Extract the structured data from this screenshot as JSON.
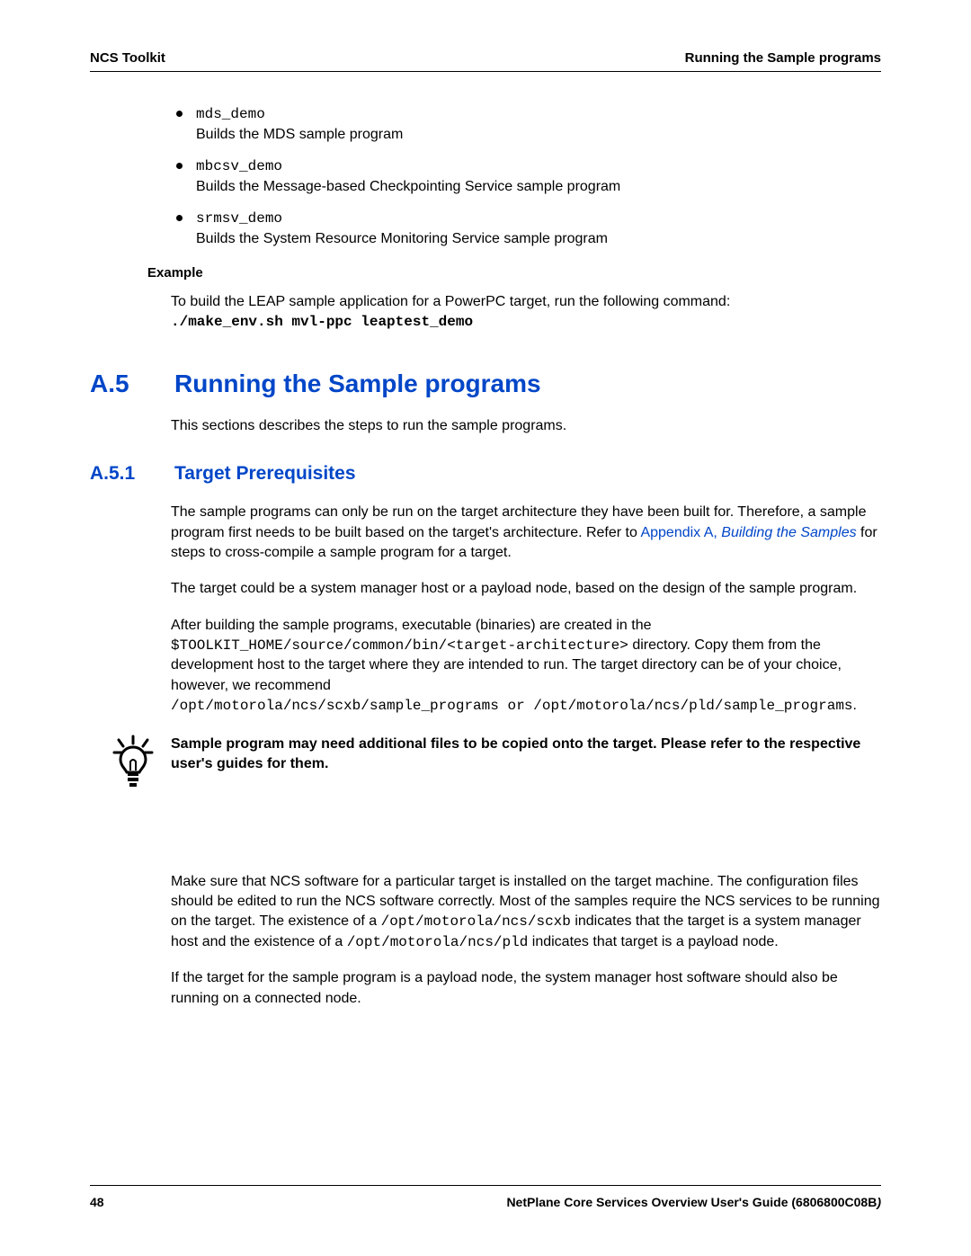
{
  "header": {
    "left": "NCS Toolkit",
    "right": "Running the Sample programs"
  },
  "bullets": [
    {
      "code": "mds_demo",
      "desc": "Builds the MDS sample program"
    },
    {
      "code": "mbcsv_demo",
      "desc": "Builds the Message-based Checkpointing Service sample program"
    },
    {
      "code": "srmsv_demo",
      "desc": "Builds the System Resource Monitoring Service sample program"
    }
  ],
  "example": {
    "label": "Example",
    "intro": "To  build the LEAP sample application for a PowerPC target, run the following command:",
    "cmd": "./make_env.sh  mvl-ppc  leaptest_demo"
  },
  "sectionA5": {
    "num": "A.5",
    "title": "Running the Sample programs",
    "intro": "This sections describes the steps to run the sample programs."
  },
  "sectionA51": {
    "num": "A.5.1",
    "title": "Target Prerequisites",
    "p1_a": "The sample programs can only be run on the target architecture they have been built for. Therefore, a sample program first needs to be built based on the target's architecture. Refer to ",
    "p1_link1": "Appendix A, ",
    "p1_link2": "Building the Samples",
    "p1_b": " for steps to cross-compile a sample program for a target.",
    "p2": "The target could be a system manager host or a payload node, based on the design of the sample program.",
    "p3_a": "After building the sample programs, executable (binaries) are created in the ",
    "p3_code1": "$TOOLKIT_HOME/source/common/bin/<target-architecture>",
    "p3_b": " directory. Copy them from the development host to the target where they are intended to run. The target directory can be of your choice, however, we recommend ",
    "p3_code2": "/opt/motorola/ncs/scxb/sample_programs or /opt/motorola/ncs/pld/sample_programs",
    "p3_c": ".",
    "tip": "Sample program may need additional files to be copied onto the target. Please refer to the respective user's guides for them.",
    "p4_a": "Make sure that NCS software for a particular target is installed on the target machine. The configuration files should be edited to run the NCS software correctly. Most of the samples require the NCS services to be running on the target. The existence of a ",
    "p4_code1": "/opt/motorola/ncs/scxb",
    "p4_b": " indicates that the target is a system manager host and the existence of a ",
    "p4_code2": "/opt/motorola/ncs/pld",
    "p4_c": " indicates that target is a payload node.",
    "p5": "If the target for the sample program is a payload node, the system manager host software should also be running on a connected node."
  },
  "footer": {
    "page": "48",
    "doc_a": "NetPlane Core Services Overview  User's Guide (6806800C08B",
    "doc_b": ")"
  }
}
